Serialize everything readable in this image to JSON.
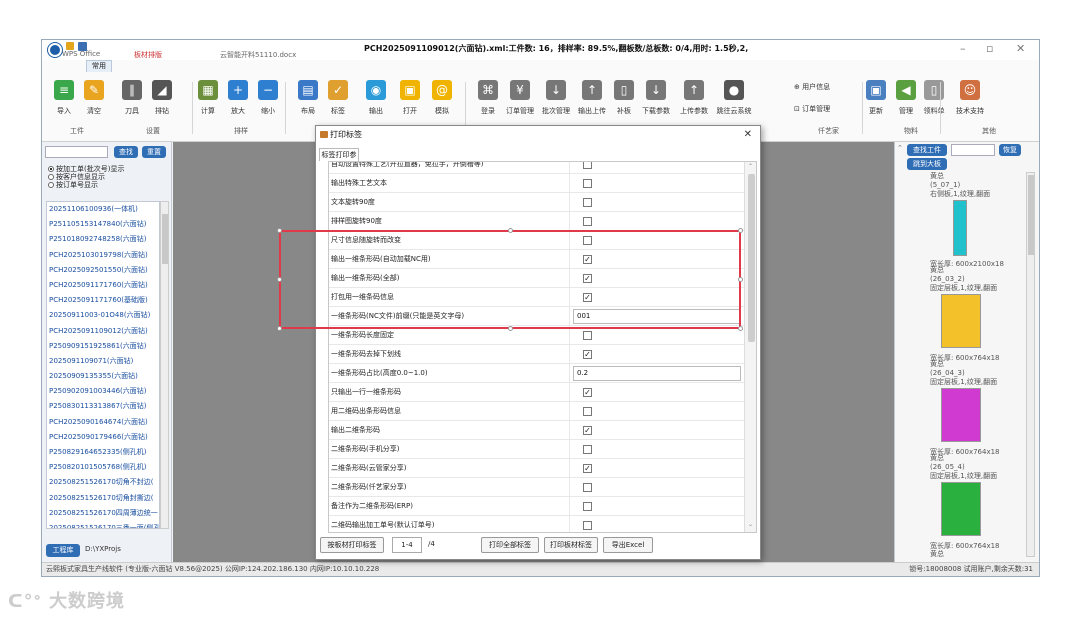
{
  "titlebar": {
    "title": "PCH2025091109012(六面钻).xml:工件数: 16，排样率: 89.5%,翻板数/总板数: 0/4,用时: 1.5秒,2,",
    "behind_left": "WPS Office",
    "behind_tab1": "板材排版",
    "behind_tab2": "云智能开料51110.docx"
  },
  "ribbon": {
    "tab": "常用",
    "buttons": [
      {
        "label": "导入",
        "color": "#3aa84a",
        "glyph": "≡"
      },
      {
        "label": "清空",
        "color": "#e9a520",
        "glyph": "✎"
      },
      {
        "label": "刀具",
        "color": "#666666",
        "glyph": "∥"
      },
      {
        "label": "排钻",
        "color": "#555555",
        "glyph": "◢"
      },
      {
        "label": "计算",
        "color": "#6b8f3a",
        "glyph": "▦"
      },
      {
        "label": "放大",
        "color": "#2f7fd0",
        "glyph": "+"
      },
      {
        "label": "缩小",
        "color": "#2f7fd0",
        "glyph": "−"
      },
      {
        "label": "布局",
        "color": "#3a78c8",
        "glyph": "▤"
      },
      {
        "label": "标签",
        "color": "#e0a030",
        "glyph": "✓"
      },
      {
        "label": "输出",
        "color": "#2a9ad8",
        "glyph": "◉"
      },
      {
        "label": "打开",
        "color": "#f0b400",
        "glyph": "▣"
      },
      {
        "label": "模拟",
        "color": "#f0b400",
        "glyph": "@"
      },
      {
        "label": "登录",
        "color": "#777777",
        "glyph": "⌘"
      },
      {
        "label": "订单管理",
        "color": "#777777",
        "glyph": "¥"
      },
      {
        "label": "批次管理",
        "color": "#777777",
        "glyph": "↓"
      },
      {
        "label": "输出上传",
        "color": "#777777",
        "glyph": "↑"
      },
      {
        "label": "补板",
        "color": "#777777",
        "glyph": "▯"
      },
      {
        "label": "下载参数",
        "color": "#777777",
        "glyph": "↓"
      },
      {
        "label": "上传参数",
        "color": "#777777",
        "glyph": "↑"
      },
      {
        "label": "跳往云系统",
        "color": "#555555",
        "glyph": "●"
      }
    ],
    "user_info": "⊕ 用户信息",
    "order_mgmt": "⊡ 订单管理",
    "groups": [
      "工件",
      "设置",
      "排样",
      "仟艺家",
      "物料",
      "其他"
    ],
    "right_buttons": [
      {
        "label": "更新",
        "color": "#4a7fc0",
        "glyph": "▣"
      },
      {
        "label": "管理",
        "color": "#5aa040",
        "glyph": "◀"
      },
      {
        "label": "领料单",
        "color": "#999999",
        "glyph": "▯"
      },
      {
        "label": "技术支持",
        "color": "#d07040",
        "glyph": "☺"
      }
    ]
  },
  "leftpanel": {
    "search_btn": "查找",
    "reset_btn": "重置",
    "radios": [
      {
        "label": "按加工单(批次号)显示",
        "checked": true
      },
      {
        "label": "按客户信息显示",
        "checked": false
      },
      {
        "label": "按订单号显示",
        "checked": false
      }
    ],
    "jobs": [
      "20251106100936(一体机)",
      "P251105153147840(六面钻)",
      "P251018092748258(六面钻)",
      "PCH2025103019798(六面钻)",
      "PCH2025092501550(六面钻)",
      "PCH2025091171760(六面钻)",
      "PCH2025091171760(基础版)",
      "20250911003-01O48(六面钻)",
      "PCH2025091109012(六面钻)",
      "P250909151925861(六面钻)",
      "2025091109071(六面钻)",
      "20250909135355(六面钻)",
      "P250902091003446(六面钻)",
      "P250830113313867(六面钻)",
      "PCH2025090164674(六面钻)",
      "PCH2025090179466(六面钻)",
      "P250829164652335(侧孔机)",
      "P250820101505768(侧孔机)",
      "202508251526170切角不封边(",
      "202508251526170切角封撕边(",
      "202508251526170四周薄边统一",
      "202508251526170三番一面(侧孔"
    ],
    "project_btn": "工程库",
    "project_path": "D:\\YXProjs"
  },
  "rightpanel": {
    "find_btn": "查找工件",
    "restore_btn": "恢复",
    "jump_btn": "跳到大板",
    "parts": [
      {
        "top_text": "黄总\n(5_07_1)\n右侧板,1,纹理,翻面",
        "bottom_text": "宽长厚: 600x2100x18",
        "color": "#22c2cc"
      },
      {
        "top_text": "黄总\n(26_03_2)\n固定层板,1,纹理,翻面",
        "bottom_text": "宽长厚: 600x764x18",
        "color": "#f3c22a"
      },
      {
        "top_text": "黄总\n(26_04_3)\n固定层板,1,纹理,翻面",
        "bottom_text": "宽长厚: 600x764x18",
        "color": "#d13ad0"
      },
      {
        "top_text": "黄总\n(26_05_4)\n固定层板,1,纹理,翻面",
        "bottom_text": "宽长厚: 600x764x18",
        "color": "#2ab03e"
      }
    ],
    "last_text": "黄总"
  },
  "dialog": {
    "title": "打印标签",
    "tab": "标签打印参数",
    "rows": [
      {
        "name": "自动设置特殊工艺(开拉直器，免拉手，开倒槽等)",
        "type": "check",
        "checked": false
      },
      {
        "name": "输出特殊工艺文本",
        "type": "check",
        "checked": false
      },
      {
        "name": "文本旋转90度",
        "type": "check",
        "checked": false
      },
      {
        "name": "排样图旋转90度",
        "type": "check",
        "checked": false
      },
      {
        "name": "尺寸信息随旋转而改变",
        "type": "check",
        "checked": false
      },
      {
        "name": "输出一维条形码(自动加载NC用)",
        "type": "check",
        "checked": true
      },
      {
        "name": "输出一维条形码(全部)",
        "type": "check",
        "checked": true
      },
      {
        "name": "打包用一维条码信息",
        "type": "check",
        "checked": true
      },
      {
        "name": "一维条形码(NC文件)前缀(只能是英文字母)",
        "type": "text",
        "value": "001"
      },
      {
        "name": "一维条形码长度固定",
        "type": "check",
        "checked": false
      },
      {
        "name": "一维条形码去掉下划线",
        "type": "check",
        "checked": true
      },
      {
        "name": "一维条形码占比(高度0.0~1.0)",
        "type": "text",
        "value": "0.2"
      },
      {
        "name": "只输出一行一维条形码",
        "type": "check",
        "checked": true
      },
      {
        "name": "用二维码出条形码信息",
        "type": "check",
        "checked": false
      },
      {
        "name": "输出二维条形码",
        "type": "check",
        "checked": true
      },
      {
        "name": "二维条形码(手机分享)",
        "type": "check",
        "checked": false
      },
      {
        "name": "二维条形码(云管家分享)",
        "type": "check",
        "checked": true
      },
      {
        "name": "二维条形码(仟艺家分享)",
        "type": "check",
        "checked": false
      },
      {
        "name": "备注作为二维条形码(ERP)",
        "type": "check",
        "checked": false
      },
      {
        "name": "二维码输出加工单号(默认订单号)",
        "type": "check",
        "checked": false
      }
    ],
    "btn_board_print": "按板材打印标签",
    "page_value": "1-4",
    "page_total": "/4",
    "btn_print_all": "打印全部标签",
    "btn_print_board": "打印板材标签",
    "btn_export": "导出Excel"
  },
  "status": {
    "left": "云熙板式家具生产线软件 (专业版-六面钻 V8.56@2025)   公网IP:124.202.186.130 内网IP:10.10.10.228",
    "right": "锁号:18008008 试用账户,剩余天数:31"
  },
  "watermark": "大数跨境"
}
